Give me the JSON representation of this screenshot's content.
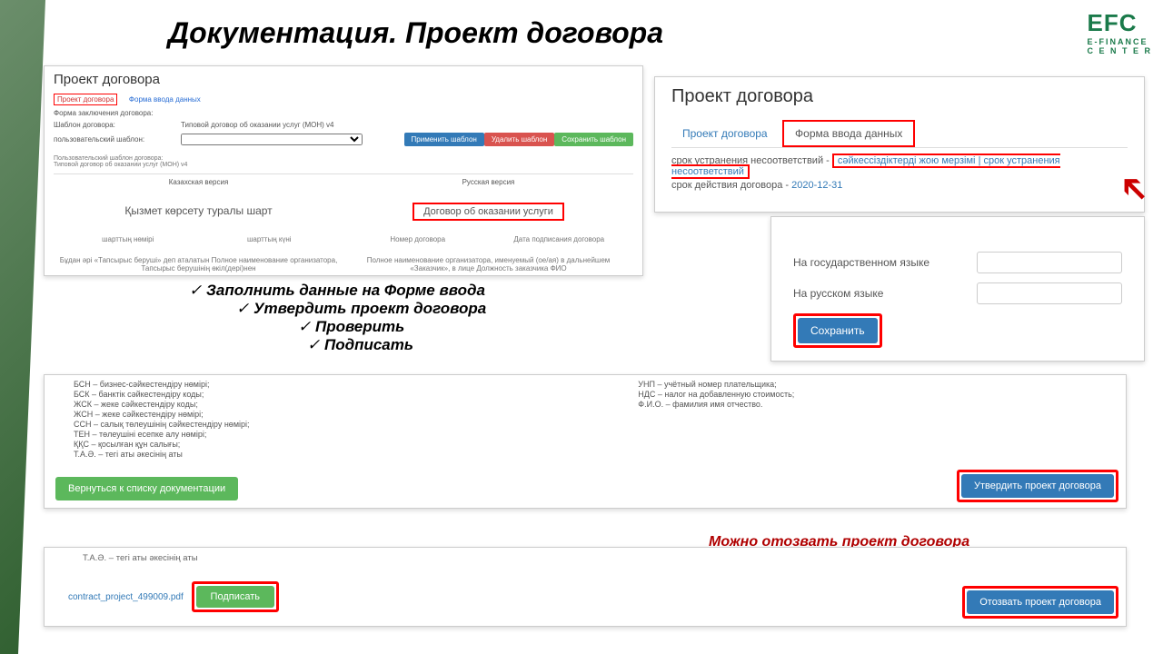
{
  "slide": {
    "title": "Документация. Проект договора",
    "logo": {
      "main": "EFC",
      "sub": "E-FINANCE",
      "sub2": "C E N T E R"
    }
  },
  "panel1": {
    "header": "Проект договора",
    "tab1": "Проект договора",
    "tab2": "Форма ввода данных",
    "form_label": "Форма заключения договора:",
    "tpl_label": "Шаблон договора:",
    "tpl_value": "Типовой договор об оказании услуг (МОН) v4",
    "user_tpl_label": "пользовательский шаблон:",
    "btn_apply": "Применить шаблон",
    "btn_del": "Удалить шаблон",
    "btn_save": "Сохранить шаблон",
    "user_tpl_info1": "Пользовательский шаблон договора:",
    "user_tpl_info2": "Типовой договор об оказании услуг (МОН) v4",
    "col_kaz": "Казахская версия",
    "col_ru": "Русская версия",
    "kaz_title": "Қызмет көрсету туралы шарт",
    "ru_title": "Договор об оказании услуги",
    "bottom1_l": "шарттың нөмірі",
    "bottom1_c": "шарттың күні",
    "bottom2_l": "Номер договора",
    "bottom2_c": "Дата подписания договора",
    "bottom3": "Бұдан әрі «Тапсырыс беруші» деп аталатын Полное наименование организатора, Тапсырыс берушінің өкіл(дері)нен",
    "bottom3r": "Полное наименование организатора, именуемый (ое/ая) в дальнейшем «Заказчик», в лице Должность заказчика ФИО"
  },
  "panel2": {
    "header": "Проект договора",
    "tab1": "Проект договора",
    "tab2": "Форма ввода данных",
    "line1_a": "срок устранения несоответствий -",
    "line1_kz": "сәйкессіздіктерді жою мерзімі",
    "line1_ru": "срок устранения несоответствий",
    "line2_a": "срок действия договора -",
    "line2_date": "2020-12-31"
  },
  "panel3": {
    "lang_kz": "На государственном языке",
    "lang_ru": "На русском языке",
    "btn": "Сохранить"
  },
  "checklist": {
    "c1": "Заполнить данные на Форме ввода",
    "c2": "Утвердить проект договора",
    "c3": "Проверить",
    "c4": "Подписать"
  },
  "panel4": {
    "left": [
      "БСН – бизнес-сәйкестендіру нөмірі;",
      "БСК – банктік сәйкестендіру коды;",
      "ЖСК – жеке сәйкестендіру коды;",
      "ЖСН – жеке сәйкестендіру нөмірі;",
      "ССН – салық төлеушінің сәйкестендіру нөмірі;",
      "ТЕН – төлеушіні есепке алу нөмірі;",
      "ҚҚС – қосылған құн салығы;",
      "Т.А.Ә. – тегі аты әкесінің аты"
    ],
    "right": [
      "УНП – учётный номер плательщика;",
      "НДС – налог на добавленную стоимость;",
      "Ф.И.О. – фамилия имя отчество."
    ],
    "btn_back": "Вернуться к списку документации",
    "btn_approve": "Утвердить проект договора"
  },
  "panel5": {
    "topline": "Т.А.Ә. – тегі аты әкесінің аты",
    "link": "contract_project_499009.pdf",
    "btn_sign": "Подписать",
    "btn_recall": "Отозвать проект договора",
    "note": "Можно отозвать проект договора"
  }
}
